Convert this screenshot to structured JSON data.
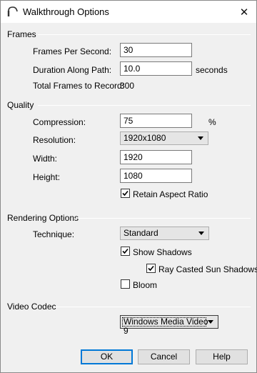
{
  "window": {
    "title": "Walkthrough Options",
    "app_icon": "arc-icon",
    "close_glyph": "✕"
  },
  "frames": {
    "group_label": "Frames",
    "fps_label": "Frames Per Second:",
    "fps_value": "30",
    "duration_label": "Duration Along Path:",
    "duration_value": "10.0",
    "duration_unit": "seconds",
    "total_label": "Total Frames to Record:",
    "total_value": "300"
  },
  "quality": {
    "group_label": "Quality",
    "compression_label": "Compression:",
    "compression_value": "75",
    "compression_unit": "%",
    "resolution_label": "Resolution:",
    "resolution_value": "1920x1080",
    "width_label": "Width:",
    "width_value": "1920",
    "height_label": "Height:",
    "height_value": "1080",
    "retain_label": "Retain Aspect Ratio",
    "retain_checked": true
  },
  "rendering": {
    "group_label": "Rendering Options",
    "technique_label": "Technique:",
    "technique_value": "Standard",
    "shadows_label": "Show Shadows",
    "shadows_checked": true,
    "raycast_label": "Ray Casted Sun Shadows",
    "raycast_checked": true,
    "bloom_label": "Bloom",
    "bloom_checked": false
  },
  "codec": {
    "group_label": "Video Codec",
    "codec_value": "Windows Media Video 9"
  },
  "buttons": {
    "ok": "OK",
    "cancel": "Cancel",
    "help": "Help"
  },
  "colors": {
    "accent": "#0078d7",
    "dialog_bg": "#f0f0f0"
  }
}
